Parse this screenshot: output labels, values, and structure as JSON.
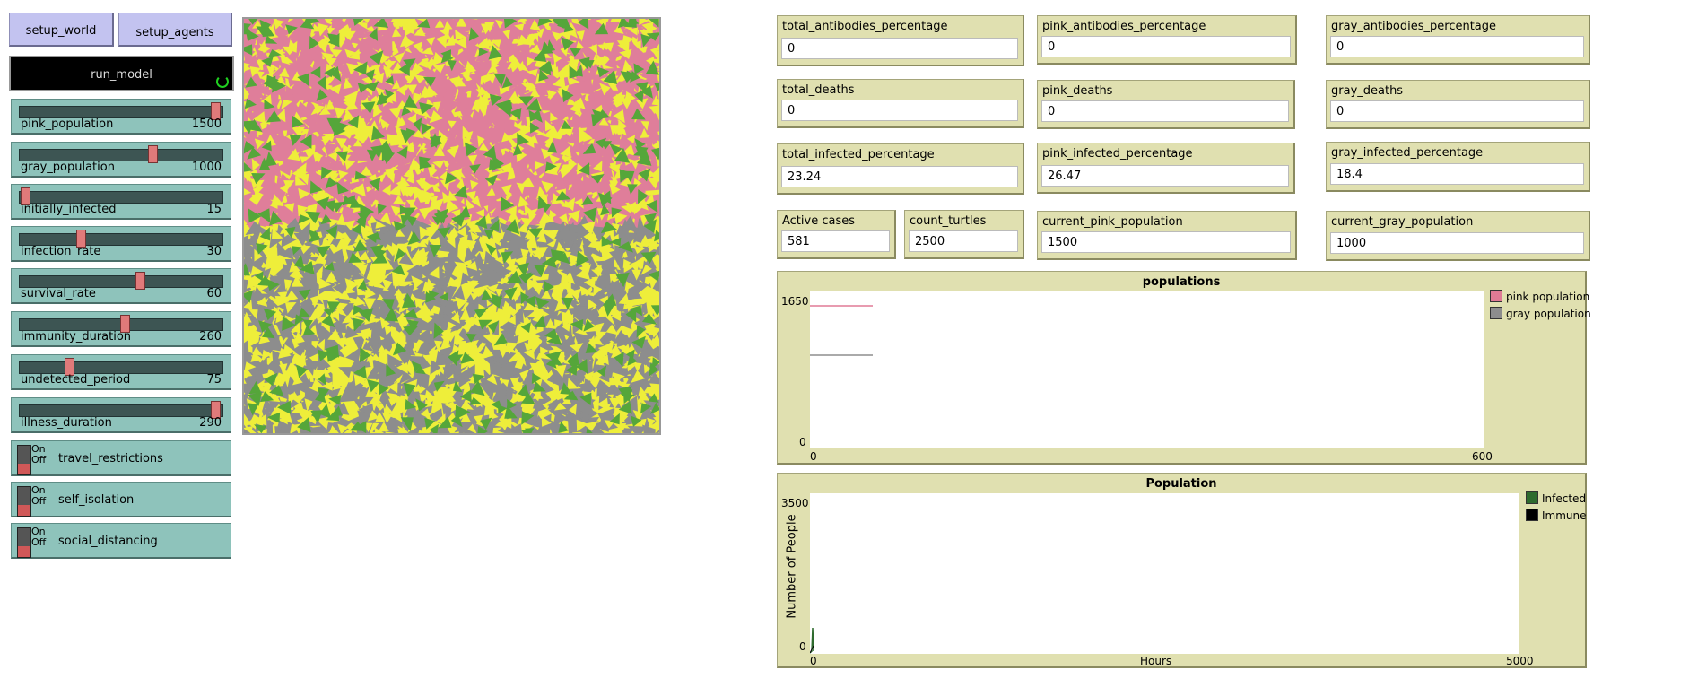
{
  "buttons": {
    "setup_world": "setup_world",
    "setup_agents": "setup_agents",
    "run_model": "run_model"
  },
  "sliders": [
    {
      "label": "pink_population",
      "value": "1500",
      "fraction": 0.97
    },
    {
      "label": "gray_population",
      "value": "1000",
      "fraction": 0.65
    },
    {
      "label": "initially_infected",
      "value": "15",
      "fraction": 0.01
    },
    {
      "label": "infection_rate",
      "value": "30",
      "fraction": 0.29
    },
    {
      "label": "survival_rate",
      "value": "60",
      "fraction": 0.59
    },
    {
      "label": "immunity_duration",
      "value": "260",
      "fraction": 0.51
    },
    {
      "label": "undetected_period",
      "value": "75",
      "fraction": 0.23
    },
    {
      "label": "illness_duration",
      "value": "290",
      "fraction": 0.97
    }
  ],
  "switches": {
    "on": "On",
    "off": "Off",
    "items": [
      {
        "label": "travel_restrictions"
      },
      {
        "label": "self_isolation"
      },
      {
        "label": "social_distancing"
      }
    ]
  },
  "monitors": {
    "total_antibodies_percentage": {
      "label": "total_antibodies_percentage",
      "value": "0"
    },
    "pink_antibodies_percentage": {
      "label": "pink_antibodies_percentage",
      "value": "0"
    },
    "gray_antibodies_percentage": {
      "label": "gray_antibodies_percentage",
      "value": "0"
    },
    "total_deaths": {
      "label": "total_deaths",
      "value": "0"
    },
    "pink_deaths": {
      "label": "pink_deaths",
      "value": "0"
    },
    "gray_deaths": {
      "label": "gray_deaths",
      "value": "0"
    },
    "total_infected_percentage": {
      "label": "total_infected_percentage",
      "value": "23.24"
    },
    "pink_infected_percentage": {
      "label": "pink_infected_percentage",
      "value": "26.47"
    },
    "gray_infected_percentage": {
      "label": "gray_infected_percentage",
      "value": "18.4"
    },
    "active_cases": {
      "label": "Active cases",
      "value": "581"
    },
    "count_turtles": {
      "label": "count_turtles",
      "value": "2500"
    },
    "current_pink_population": {
      "label": "current_pink_population",
      "value": "1500"
    },
    "current_gray_population": {
      "label": "current_gray_population",
      "value": "1000"
    }
  },
  "plots": {
    "populations": {
      "title": "populations",
      "ymax": "1650",
      "ymin": "0",
      "xmin": "0",
      "xmax": "600",
      "legend": [
        {
          "name": "pink population",
          "color": "#e07a95"
        },
        {
          "name": "gray population",
          "color": "#8d8d8d"
        }
      ]
    },
    "population": {
      "title": "Population",
      "ymax": "3500",
      "ymin": "0",
      "xmin": "0",
      "xmax": "5000",
      "xlabel": "Hours",
      "ylabel": "Number of People",
      "legend": [
        {
          "name": "Infected",
          "color": "#2e6b2e"
        },
        {
          "name": "Immune",
          "color": "#000000"
        }
      ]
    }
  },
  "world": {
    "colors": {
      "pink": "#df7e9a",
      "yellow": "#eeee3a",
      "gray": "#8d8d8d",
      "green": "#55a63a"
    }
  }
}
